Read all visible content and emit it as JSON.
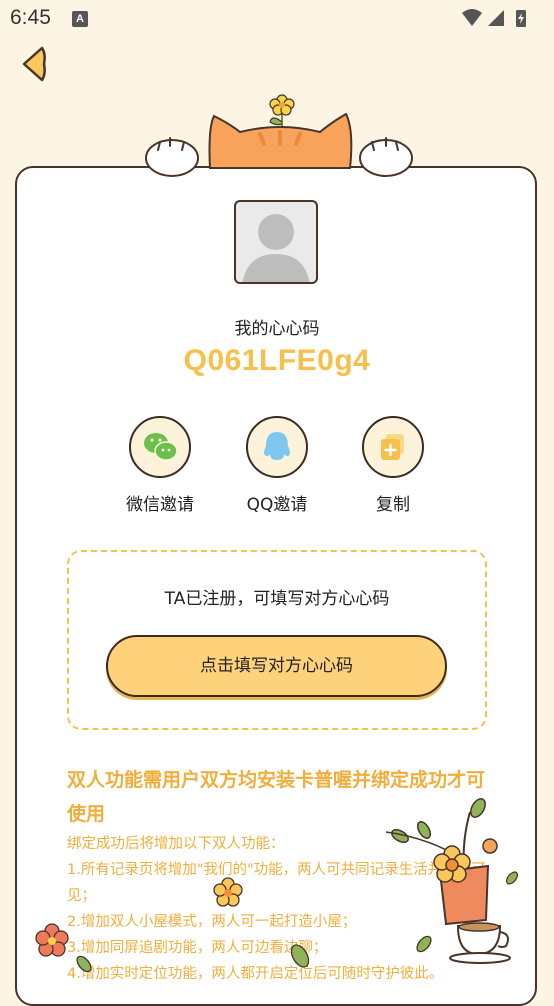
{
  "status_bar": {
    "time": "6:45",
    "notification_icon_letter": "A"
  },
  "profile": {
    "code_label": "我的心心码",
    "code_value": "Q061LFE0g4"
  },
  "share": [
    {
      "label": "微信邀请",
      "icon": "wechat-icon"
    },
    {
      "label": "QQ邀请",
      "icon": "qq-icon"
    },
    {
      "label": "复制",
      "icon": "copy-icon"
    }
  ],
  "invite": {
    "hint": "TA已注册，可填写对方心心码",
    "button_label": "点击填写对方心心码"
  },
  "features": {
    "title": "双人功能需用户双方均安装卡普喔并绑定成功才可使用",
    "intro": "绑定成功后将增加以下双人功能：",
    "items": [
      "1.所有记录页将增加\"我们的\"功能，两人可共同记录生活并互相可见；",
      "2.增加双人小屋模式，两人可一起打造小屋；",
      "3.增加同屏追剧功能，两人可边看边聊；",
      "4.增加实时定位功能，两人都开启定位后可随时守护彼此。"
    ]
  },
  "colors": {
    "background": "#fdf5e4",
    "accent": "#f8c04b",
    "button": "#fdd27a",
    "outline": "#4a342a"
  }
}
